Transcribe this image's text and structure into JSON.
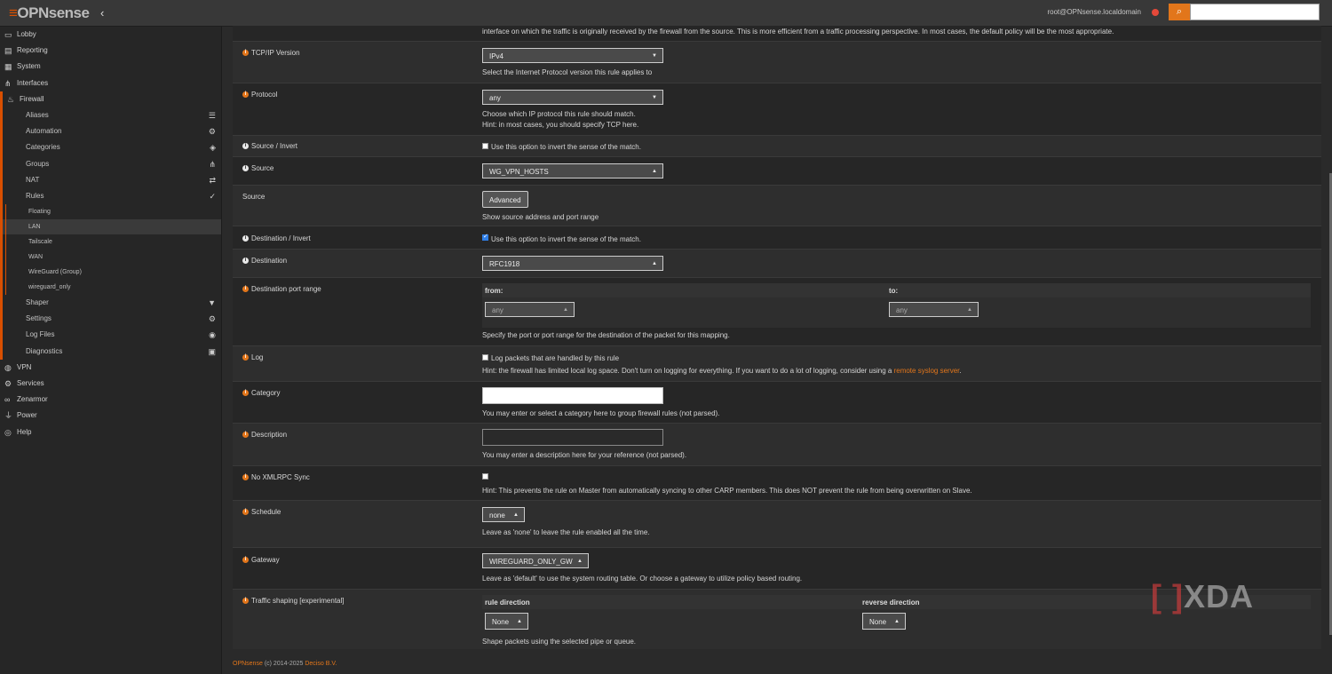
{
  "header": {
    "logo": "OPNsense",
    "user": "root@OPNsense.localdomain"
  },
  "sidebar": {
    "items": [
      {
        "label": "Lobby",
        "icon": "laptop-icon",
        "level": 1
      },
      {
        "label": "Reporting",
        "icon": "chart-icon",
        "level": 1
      },
      {
        "label": "System",
        "icon": "server-icon",
        "level": 1
      },
      {
        "label": "Interfaces",
        "icon": "sitemap-icon",
        "level": 1
      },
      {
        "label": "Firewall",
        "icon": "fire-icon",
        "level": 1
      },
      {
        "label": "Aliases",
        "icon": "list-icon",
        "level": 2
      },
      {
        "label": "Automation",
        "icon": "gear-icon",
        "level": 2
      },
      {
        "label": "Categories",
        "icon": "tags-icon",
        "level": 2
      },
      {
        "label": "Groups",
        "icon": "sitemap-icon",
        "level": 2
      },
      {
        "label": "NAT",
        "icon": "exchange-icon",
        "level": 2
      },
      {
        "label": "Rules",
        "icon": "check-icon",
        "level": 2
      },
      {
        "label": "Floating",
        "level": 3
      },
      {
        "label": "LAN",
        "level": 3,
        "active": true
      },
      {
        "label": "Tailscale",
        "level": 3
      },
      {
        "label": "WAN",
        "level": 3
      },
      {
        "label": "WireGuard (Group)",
        "level": 3
      },
      {
        "label": "wireguard_only",
        "level": 3
      },
      {
        "label": "Shaper",
        "icon": "filter-icon",
        "level": 2
      },
      {
        "label": "Settings",
        "icon": "gears-icon",
        "level": 2
      },
      {
        "label": "Log Files",
        "icon": "eye-icon",
        "level": 2
      },
      {
        "label": "Diagnostics",
        "icon": "medkit-icon",
        "level": 2
      },
      {
        "label": "VPN",
        "icon": "globe-icon",
        "level": 1
      },
      {
        "label": "Services",
        "icon": "cog-icon",
        "level": 1
      },
      {
        "label": "Zenarmor",
        "icon": "binoculars-icon",
        "level": 1
      },
      {
        "label": "Power",
        "icon": "plug-icon",
        "level": 1
      },
      {
        "label": "Help",
        "icon": "lifebuoy-icon",
        "level": 1
      }
    ]
  },
  "form": {
    "intro_text": "interface on which the traffic is originally received by the firewall from the source. This is more efficient from a traffic processing perspective. In most cases, the default policy will be the most appropriate.",
    "tcpip": {
      "label": "TCP/IP Version",
      "value": "IPv4",
      "help": "Select the Internet Protocol version this rule applies to"
    },
    "protocol": {
      "label": "Protocol",
      "value": "any",
      "help": "Choose which IP protocol this rule should match.",
      "hint": "Hint: in most cases, you should specify TCP here."
    },
    "source_invert": {
      "label": "Source / Invert",
      "help": "Use this option to invert the sense of the match."
    },
    "source": {
      "label": "Source",
      "value": "WG_VPN_HOSTS"
    },
    "source_adv": {
      "label": "Source",
      "button": "Advanced",
      "help": "Show source address and port range"
    },
    "dest_invert": {
      "label": "Destination / Invert",
      "help": "Use this option to invert the sense of the match."
    },
    "destination": {
      "label": "Destination",
      "value": "RFC1918"
    },
    "dest_port": {
      "label": "Destination port range",
      "from_label": "from:",
      "to_label": "to:",
      "from_value": "any",
      "to_value": "any",
      "help": "Specify the port or port range for the destination of the packet for this mapping."
    },
    "log": {
      "label": "Log",
      "help": "Log packets that are handled by this rule",
      "hint": "Hint: the firewall has limited local log space. Don't turn on logging for everything. If you want to do a lot of logging, consider using a",
      "link": "remote syslog server",
      "hint_end": "."
    },
    "category": {
      "label": "Category",
      "help": "You may enter or select a category here to group firewall rules (not parsed)."
    },
    "description": {
      "label": "Description",
      "help": "You may enter a description here for your reference (not parsed)."
    },
    "xmlrpc": {
      "label": "No XMLRPC Sync",
      "hint": "Hint: This prevents the rule on Master from automatically syncing to other CARP members. This does NOT prevent the rule from being overwritten on Slave."
    },
    "schedule": {
      "label": "Schedule",
      "value": "none",
      "help": "Leave as 'none' to leave the rule enabled all the time."
    },
    "gateway": {
      "label": "Gateway",
      "value": "WIREGUARD_ONLY_GW",
      "help": "Leave as 'default' to use the system routing table. Or choose a gateway to utilize policy based routing."
    },
    "shaping": {
      "label": "Traffic shaping [experimental]",
      "rule_dir": "rule direction",
      "rev_dir": "reverse direction",
      "rule_value": "None",
      "rev_value": "None",
      "help": "Shape packets using the selected pipe or queue."
    }
  },
  "footer": {
    "brand": "OPNsense",
    "text": "(c) 2014-2025",
    "company": "Deciso B.V."
  },
  "watermark": "XDA"
}
